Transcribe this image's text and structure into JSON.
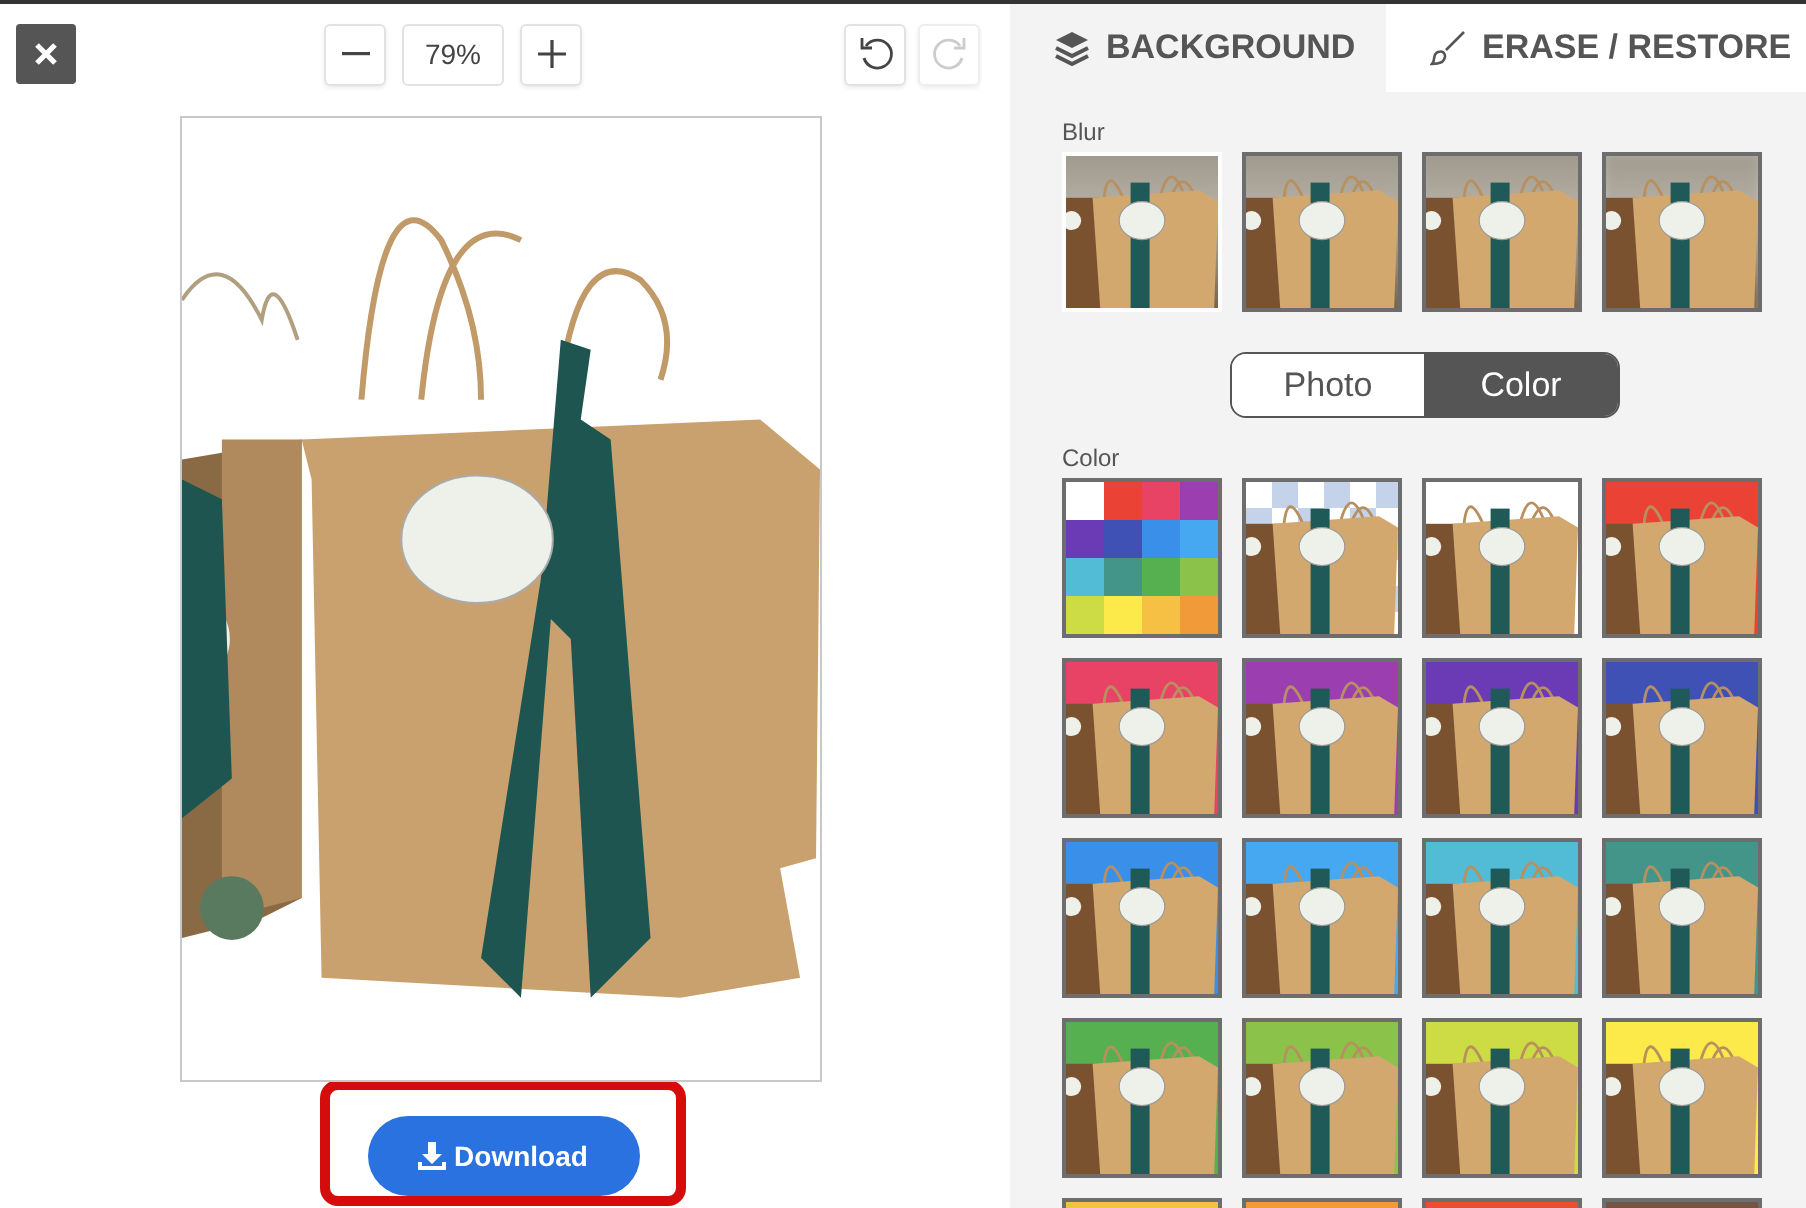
{
  "zoom": {
    "value": "79%"
  },
  "history": [
    {
      "kind": "undo",
      "disabled": false
    },
    {
      "kind": "redo",
      "disabled": true
    }
  ],
  "tabs": [
    {
      "kind": "layers",
      "label": "BACKGROUND",
      "selected": true
    },
    {
      "kind": "brush",
      "label": "ERASE / RESTORE",
      "selected": false
    }
  ],
  "blur": {
    "label": "Blur",
    "options": [
      {
        "selected": true
      },
      {
        "selected": false
      },
      {
        "selected": false
      },
      {
        "selected": false
      }
    ]
  },
  "mode_toggle": [
    {
      "label": "Photo",
      "selected": false
    },
    {
      "label": "Color",
      "selected": true
    }
  ],
  "color": {
    "label": "Color",
    "swatches": [
      {
        "kind": "palette"
      },
      {
        "kind": "transparent"
      },
      {
        "kind": "color",
        "color": "#ffffff"
      },
      {
        "kind": "color",
        "color": "#ea4335"
      },
      {
        "kind": "color",
        "color": "#e84365"
      },
      {
        "kind": "color",
        "color": "#9b3fb0"
      },
      {
        "kind": "color",
        "color": "#6a3bb5"
      },
      {
        "kind": "color",
        "color": "#3f51b5"
      },
      {
        "kind": "color",
        "color": "#3a8fe8"
      },
      {
        "kind": "color",
        "color": "#45a8f0"
      },
      {
        "kind": "color",
        "color": "#52bcd6"
      },
      {
        "kind": "color",
        "color": "#439589"
      },
      {
        "kind": "color",
        "color": "#56b050"
      },
      {
        "kind": "color",
        "color": "#8bc34a"
      },
      {
        "kind": "color",
        "color": "#cddc45"
      },
      {
        "kind": "color",
        "color": "#fce94a"
      },
      {
        "kind": "color",
        "color": "#f5c044"
      },
      {
        "kind": "color",
        "color": "#f09a3a"
      },
      {
        "kind": "color",
        "color": "#ea4d32"
      },
      {
        "kind": "color",
        "color": "#755446"
      }
    ]
  },
  "download": {
    "label": "Download",
    "highlighted": true
  }
}
